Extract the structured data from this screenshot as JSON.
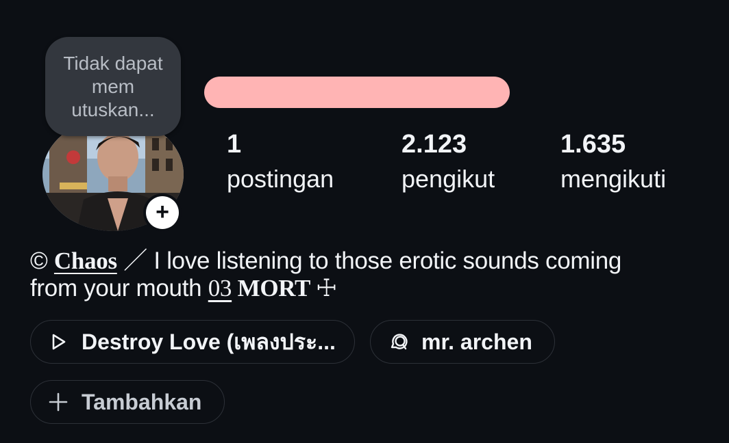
{
  "note": {
    "text": "Tidak dapat mem utuskan..."
  },
  "avatar": {
    "add_icon": "plus-icon"
  },
  "stats": [
    {
      "value": "1",
      "label": "postingan"
    },
    {
      "value": "2.123",
      "label": "pengikut"
    },
    {
      "value": "1.635",
      "label": "mengikuti"
    }
  ],
  "bio": {
    "prefix": "© ",
    "name": "Chaos",
    "line1_rest": " ／ I love listening to those erotic sounds coming",
    "line2": "from your mouth ",
    "number": "03",
    "mort": " MORT ",
    "cross": "☩"
  },
  "chips": {
    "music": {
      "label": "Destroy Love (เพลงประ...",
      "icon": "play-icon"
    },
    "threads": {
      "label": "mr. archen",
      "icon": "threads-icon"
    },
    "add": {
      "label": "Tambahkan",
      "icon": "plus-icon"
    }
  },
  "colors": {
    "background": "#0c0f14",
    "redaction": "#ffb4b4",
    "note_bubble": "#33373e",
    "chip_border": "#2d3138"
  }
}
